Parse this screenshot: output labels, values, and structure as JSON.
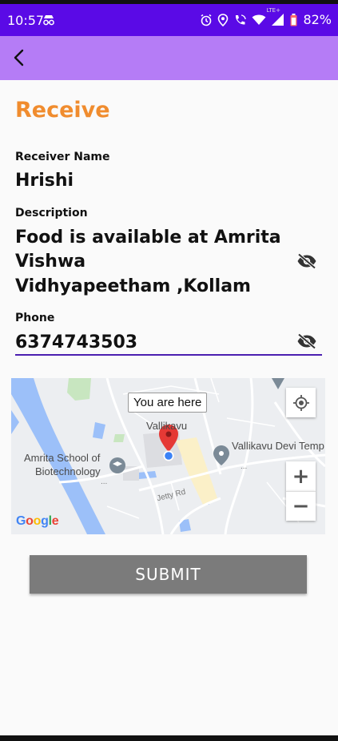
{
  "status_bar": {
    "time": "10:57",
    "battery": "82%",
    "lte": "LTE+",
    "icons": [
      "incognito-icon",
      "alarm-icon",
      "location-icon",
      "wifi-call-icon",
      "wifi-icon",
      "signal-icon",
      "battery-icon"
    ]
  },
  "app_bar": {
    "back_icon": "back-arrow-icon",
    "color": "#b57cf6"
  },
  "form": {
    "title": "Receive",
    "receiver_label": "Receiver Name",
    "receiver_value": "Hrishi",
    "description_label": "Description",
    "description_lines": [
      "Food is available at Amrita",
      "Vishwa",
      "Vidhyapeetham ,Kollam"
    ],
    "phone_label": "Phone",
    "phone_value": "6374743503",
    "visibility_icon": "eye-off-icon"
  },
  "map": {
    "tooltip": "You are here",
    "place_vallikavu": "Vallikavu",
    "place_temple": "Vallikavu Devi Temp",
    "place_school_line1": "Amrita School of",
    "place_school_line2": "Biotechnology",
    "road": "Jetty Rd",
    "ellipsis": "...",
    "zoom_in": "+",
    "zoom_out": "−",
    "logo": "Google"
  },
  "submit_label": "SUBMIT",
  "colors": {
    "status_bar": "#5a0ae6",
    "app_bar": "#b57cf6",
    "title": "#f08c2e",
    "underline": "#4b1fb0",
    "submit": "#7b7b7b"
  }
}
